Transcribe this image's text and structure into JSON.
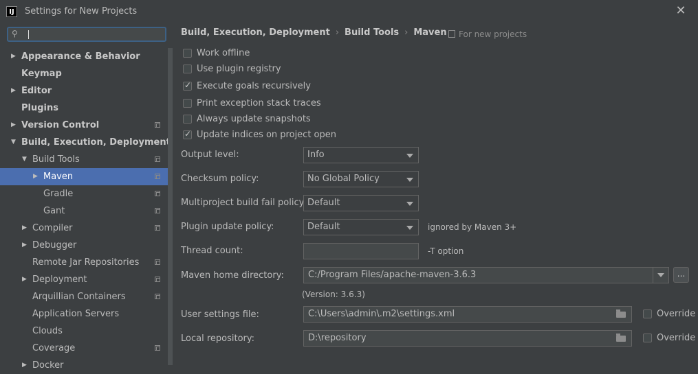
{
  "window": {
    "title": "Settings for New Projects",
    "app_icon": "IJ"
  },
  "sidebar": {
    "search": {
      "value": ""
    },
    "items": [
      {
        "label": "Appearance & Behavior",
        "arrow": "▶",
        "level": 0,
        "bold": true,
        "copy": false
      },
      {
        "label": "Keymap",
        "arrow": "",
        "level": 0,
        "bold": true,
        "copy": false
      },
      {
        "label": "Editor",
        "arrow": "▶",
        "level": 0,
        "bold": true,
        "copy": false
      },
      {
        "label": "Plugins",
        "arrow": "",
        "level": 0,
        "bold": true,
        "copy": false
      },
      {
        "label": "Version Control",
        "arrow": "▶",
        "level": 0,
        "bold": true,
        "copy": true
      },
      {
        "label": "Build, Execution, Deployment",
        "arrow": "▼",
        "level": 0,
        "bold": true,
        "copy": false
      },
      {
        "label": "Build Tools",
        "arrow": "▼",
        "level": 1,
        "bold": false,
        "copy": true
      },
      {
        "label": "Maven",
        "arrow": "▶",
        "level": 2,
        "bold": false,
        "copy": true,
        "selected": true
      },
      {
        "label": "Gradle",
        "arrow": "",
        "level": 2,
        "bold": false,
        "copy": true
      },
      {
        "label": "Gant",
        "arrow": "",
        "level": 2,
        "bold": false,
        "copy": true
      },
      {
        "label": "Compiler",
        "arrow": "▶",
        "level": 1,
        "bold": false,
        "copy": true
      },
      {
        "label": "Debugger",
        "arrow": "▶",
        "level": 1,
        "bold": false,
        "copy": false
      },
      {
        "label": "Remote Jar Repositories",
        "arrow": "",
        "level": 1,
        "bold": false,
        "copy": true
      },
      {
        "label": "Deployment",
        "arrow": "▶",
        "level": 1,
        "bold": false,
        "copy": true
      },
      {
        "label": "Arquillian Containers",
        "arrow": "",
        "level": 1,
        "bold": false,
        "copy": true
      },
      {
        "label": "Application Servers",
        "arrow": "",
        "level": 1,
        "bold": false,
        "copy": false
      },
      {
        "label": "Clouds",
        "arrow": "",
        "level": 1,
        "bold": false,
        "copy": false
      },
      {
        "label": "Coverage",
        "arrow": "",
        "level": 1,
        "bold": false,
        "copy": true
      },
      {
        "label": "Docker",
        "arrow": "▶",
        "level": 1,
        "bold": false,
        "copy": false
      }
    ]
  },
  "breadcrumb": {
    "part1": "Build, Execution, Deployment",
    "part2": "Build Tools",
    "part3": "Maven",
    "sep": "›"
  },
  "scope_label": "For new projects",
  "checkboxes": [
    {
      "label": "Work offline",
      "checked": false
    },
    {
      "label": "Use plugin registry",
      "checked": false
    },
    {
      "label": "Execute goals recursively",
      "checked": true
    },
    {
      "label": "Print exception stack traces",
      "checked": false
    },
    {
      "label": "Always update snapshots",
      "checked": false
    },
    {
      "label": "Update indices on project open",
      "checked": true
    }
  ],
  "fields": {
    "output_level": {
      "label": "Output level:",
      "value": "Info"
    },
    "checksum_policy": {
      "label": "Checksum policy:",
      "value": "No Global Policy"
    },
    "multiproject_fail": {
      "label": "Multiproject build fail policy:",
      "value": "Default"
    },
    "plugin_update": {
      "label": "Plugin update policy:",
      "value": "Default",
      "hint": "ignored by Maven 3+"
    },
    "thread_count": {
      "label": "Thread count:",
      "value": "",
      "hint": "-T option"
    },
    "maven_home": {
      "label": "Maven home directory:",
      "value": "C:/Program Files/apache-maven-3.6.3",
      "browse": "...",
      "version": "(Version: 3.6.3)"
    },
    "user_settings": {
      "label": "User settings file:",
      "value": "C:\\Users\\admin\\.m2\\settings.xml",
      "override": "Override"
    },
    "local_repo": {
      "label": "Local repository:",
      "value": "D:\\repository",
      "override": "Override"
    }
  },
  "colors": {
    "background": "#3c3f41",
    "selection": "#4b6eaf",
    "focus": "#3d6185"
  }
}
